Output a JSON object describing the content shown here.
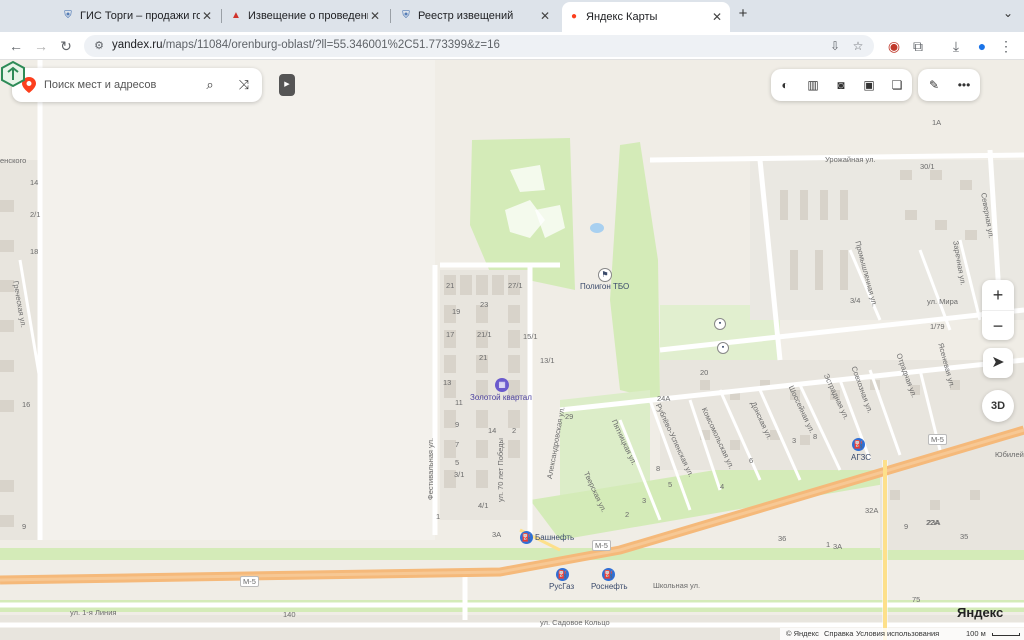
{
  "browser": {
    "tabs": [
      {
        "title": "ГИС Торги – продажи госуд",
        "icon": "gov-emblem-icon"
      },
      {
        "title": "Извещение о проведении то",
        "icon": "torgi-icon"
      },
      {
        "title": "Реестр извещений",
        "icon": "gov-emblem-icon"
      },
      {
        "title": "Яндекс Карты",
        "icon": "yandex-maps-pin-icon"
      }
    ],
    "url_host": "yandex.ru",
    "url_path": "/maps/11084/orenburg-oblast/?ll=55.346001%2C51.773399&z=16"
  },
  "search": {
    "placeholder": "Поиск мест и адресов"
  },
  "map_controls": {
    "zoom_in": "+",
    "zoom_out": "−",
    "threed": "3D"
  },
  "map_labels": {
    "poi_landfill": "Полигон ТБО",
    "poi_golden_quarter": "Золотой квартал",
    "poi_bashneft": "Башнефть",
    "poi_rusgaz": "РусГаз",
    "poi_rosneft": "Роснефть",
    "poi_azs": "АГЗС",
    "street_urozhaynaya": "Урожайная ул.",
    "street_mira": "ул. Мира",
    "street_shkolnaya": "Школьная ул.",
    "street_liniya": "ул. 1-я Линия",
    "street_sadovoe": "ул. Садовое Кольцо",
    "street_festivalnaya": "Фестивальная ул.",
    "street_70let": "ул. 70 лет Победы",
    "street_aleksandrovskaya": "Александровская ул.",
    "street_grecheskaya": "Греческая ул.",
    "street_severnaya": "Северная ул.",
    "street_zadachnaya": "Заречная ул.",
    "street_promyshlennaya": "Промышленная ул.",
    "street_pyatnitskaya": "Пятницкая ул.",
    "street_tverskaya": "Тверская ул.",
    "street_rublevo": "Рублёво-Успенская ул.",
    "street_komsomolskaya": "Комсомольская ул.",
    "street_donskaya": "Донская ул.",
    "street_shosseynaya": "Шоссейная ул.",
    "street_estradnaya": "Эстрадная ул.",
    "street_sovkhoznaya": "Совхозная ул.",
    "street_otradnaya": "Отрадная ул.",
    "street_yasenevaya": "Ясеневая ул.",
    "street_yubileynaya": "Юбилей",
    "street_enskogo": "енского",
    "road_m5": "М-5",
    "house_numbers": [
      "14",
      "2/1",
      "18",
      "16",
      "9",
      "21",
      "27/1",
      "23",
      "19",
      "17",
      "21/1",
      "15/1",
      "21",
      "13/1",
      "13",
      "11",
      "9",
      "7",
      "5",
      "3/1",
      "4/1",
      "1",
      "14",
      "2",
      "3А",
      "1А",
      "30/1",
      "35",
      "22А",
      "36",
      "24А",
      "3А",
      "75",
      "140",
      "3/4",
      "1/79",
      "20",
      "29",
      "8",
      "6",
      "4",
      "2",
      "3",
      "5",
      "8",
      "3",
      "1",
      "9",
      "32А",
      "23А"
    ]
  },
  "logo": "Яндекс",
  "footer": {
    "copyright": "© Яндекс",
    "help": "Справка",
    "terms": "Условия использования",
    "scale": "100 м"
  },
  "colors": {
    "map_bg": "#f0ede6",
    "park": "#d4ebb8",
    "highway": "#f5b97a",
    "road": "#ffffff",
    "yandex_red": "#fc3f1d"
  }
}
